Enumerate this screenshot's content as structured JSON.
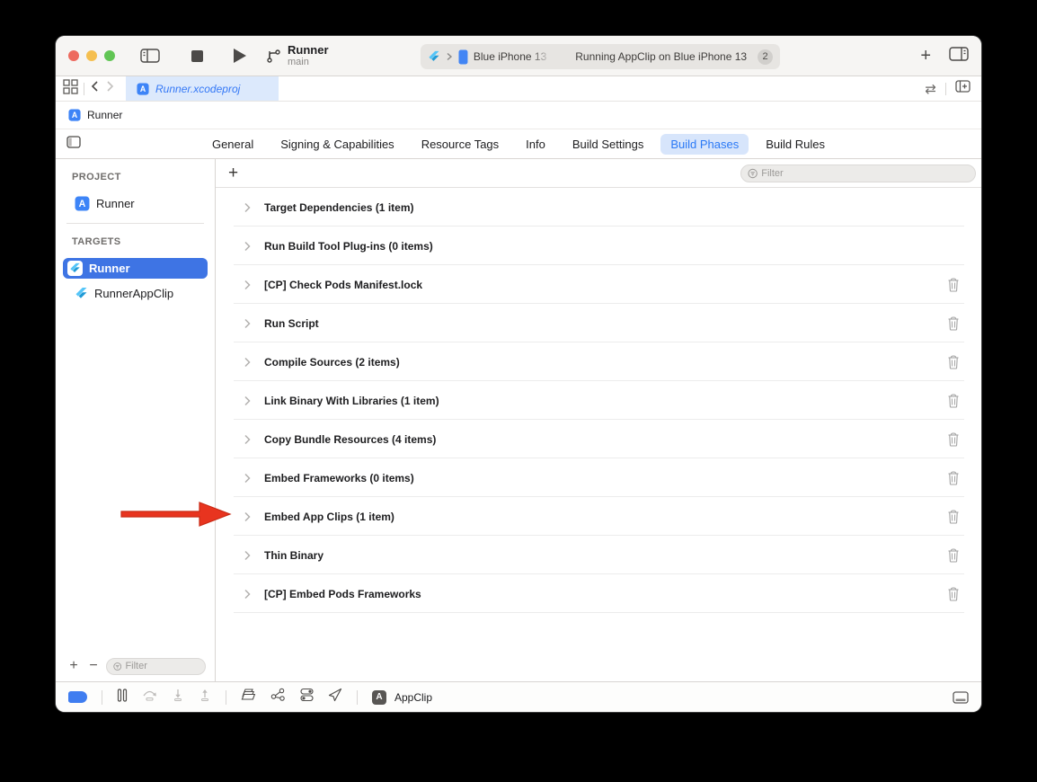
{
  "toolbar": {
    "title": "Runner",
    "subtitle": "main",
    "device": "Blue iPhone 13",
    "status": "Running AppClip on Blue iPhone 13",
    "badge": "2"
  },
  "tabbar": {
    "tab_label": "Runner.xcodeproj"
  },
  "jumpbar": {
    "label": "Runner"
  },
  "config_tabs": {
    "items": [
      "General",
      "Signing & Capabilities",
      "Resource Tags",
      "Info",
      "Build Settings",
      "Build Phases",
      "Build Rules"
    ],
    "selected": "Build Phases"
  },
  "sidebar": {
    "project_header": "PROJECT",
    "project_item": "Runner",
    "targets_header": "TARGETS",
    "target_selected": "Runner",
    "target_secondary": "RunnerAppClip",
    "filter_placeholder": "Filter"
  },
  "content": {
    "filter_placeholder": "Filter",
    "phases": [
      {
        "label": "Target Dependencies (1 item)",
        "deletable": false
      },
      {
        "label": "Run Build Tool Plug-ins (0 items)",
        "deletable": false
      },
      {
        "label": "[CP] Check Pods Manifest.lock",
        "deletable": true
      },
      {
        "label": "Run Script",
        "deletable": true
      },
      {
        "label": "Compile Sources (2 items)",
        "deletable": true
      },
      {
        "label": "Link Binary With Libraries (1 item)",
        "deletable": true
      },
      {
        "label": "Copy Bundle Resources (4 items)",
        "deletable": true
      },
      {
        "label": "Embed Frameworks (0 items)",
        "deletable": true
      },
      {
        "label": "Embed App Clips (1 item)",
        "deletable": true,
        "annotated": true
      },
      {
        "label": "Thin Binary",
        "deletable": true
      },
      {
        "label": "[CP] Embed Pods Frameworks",
        "deletable": true
      }
    ]
  },
  "debugbar": {
    "app_label": "AppClip"
  },
  "colors": {
    "accent_blue": "#3478f6",
    "target_selection": "#3e74e4",
    "tab_selected_bg": "#d7e5fb",
    "arrow_red": "#e8341f"
  }
}
